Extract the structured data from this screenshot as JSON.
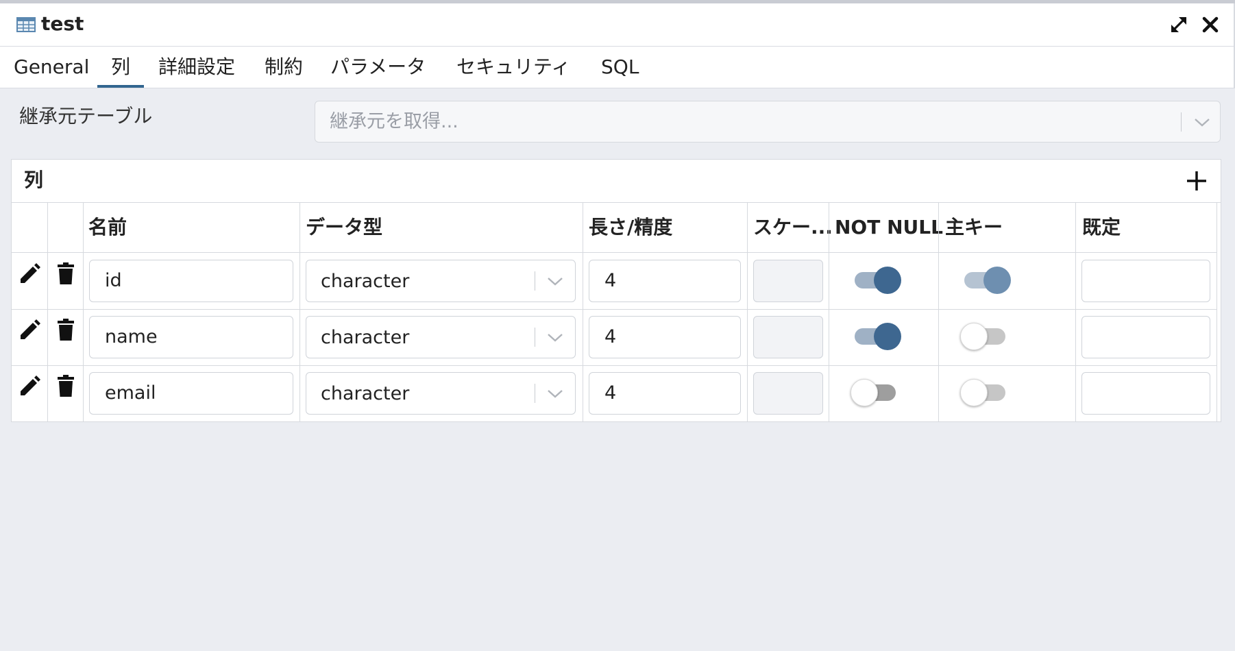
{
  "window": {
    "title": "test",
    "icons": {
      "title": "table-icon",
      "expand": "expand-icon",
      "close": "close-icon"
    }
  },
  "tabs": [
    {
      "label": "General",
      "active": false
    },
    {
      "label": "列",
      "active": true
    },
    {
      "label": "詳細設定",
      "active": false
    },
    {
      "label": "制約",
      "active": false
    },
    {
      "label": "パラメータ",
      "active": false
    },
    {
      "label": "セキュリティ",
      "active": false
    },
    {
      "label": "SQL",
      "active": false
    }
  ],
  "inherit": {
    "label": "継承元テーブル",
    "placeholder": "継承元を取得..."
  },
  "columns_panel": {
    "title": "列",
    "headers": {
      "name": "名前",
      "data_type": "データ型",
      "length": "長さ/精度",
      "scale": "スケー...",
      "not_null": "NOT NULL",
      "primary_key": "主キー",
      "default": "既定"
    },
    "rows": [
      {
        "name": "id",
        "data_type": "character",
        "length": "4",
        "scale": "",
        "not_null": true,
        "primary_key": true,
        "default": ""
      },
      {
        "name": "name",
        "data_type": "character",
        "length": "4",
        "scale": "",
        "not_null": true,
        "primary_key": false,
        "default": ""
      },
      {
        "name": "email",
        "data_type": "character",
        "length": "4",
        "scale": "",
        "not_null": false,
        "primary_key": false,
        "default": ""
      }
    ]
  },
  "colors": {
    "accent": "#326690",
    "toggle_on": "#3e6790",
    "background": "#ebedf2"
  }
}
